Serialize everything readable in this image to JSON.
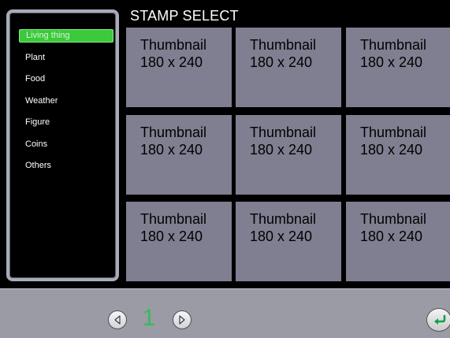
{
  "app": {
    "title": "STAMP SELECT"
  },
  "categories": [
    {
      "label": "Living thing",
      "selected": true
    },
    {
      "label": "Plant",
      "selected": false
    },
    {
      "label": "Food",
      "selected": false
    },
    {
      "label": "Weather",
      "selected": false
    },
    {
      "label": "Figure",
      "selected": false
    },
    {
      "label": "Coins",
      "selected": false
    },
    {
      "label": "Others",
      "selected": false
    }
  ],
  "thumbnails": [
    {
      "line1": "Thumbnail",
      "line2": "180 x 240"
    },
    {
      "line1": "Thumbnail",
      "line2": "180 x 240"
    },
    {
      "line1": "Thumbnail",
      "line2": "180 x 240"
    },
    {
      "line1": "Thumbnail",
      "line2": "180 x 240"
    },
    {
      "line1": "Thumbnail",
      "line2": "180 x 240"
    },
    {
      "line1": "Thumbnail",
      "line2": "180 x 240"
    },
    {
      "line1": "Thumbnail",
      "line2": "180 x 240"
    },
    {
      "line1": "Thumbnail",
      "line2": "180 x 240"
    },
    {
      "line1": "Thumbnail",
      "line2": "180 x 240"
    }
  ],
  "pagination": {
    "page_number": "1",
    "previous_icon": "chevron-left-icon",
    "next_icon": "chevron-right-icon"
  },
  "actions": {
    "back_icon": "return-arrow-icon"
  },
  "colors": {
    "background": "#000000",
    "selected_category": "#3cc93c",
    "thumbnail_tile": "#807f91",
    "bottom_bar": "#9a9ba4",
    "page_number": "#39b95b",
    "back_arrow": "#0fa04d"
  }
}
